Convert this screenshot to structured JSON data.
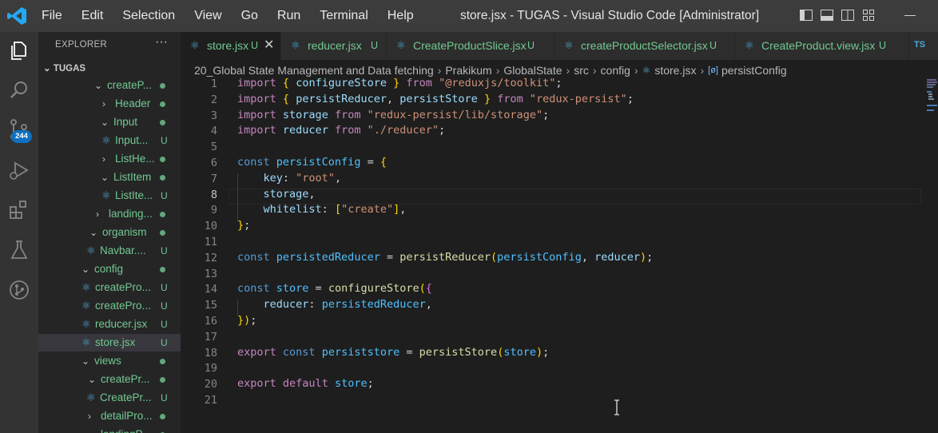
{
  "window": {
    "title": "store.jsx - TUGAS - Visual Studio Code [Administrator]",
    "menu": [
      "File",
      "Edit",
      "Selection",
      "View",
      "Go",
      "Run",
      "Terminal",
      "Help"
    ]
  },
  "activity_bar": {
    "items": [
      "explorer-icon",
      "search-icon",
      "source-control-icon",
      "run-debug-icon",
      "extensions-icon",
      "testing-icon",
      "git-graph-icon"
    ],
    "source_control_badge": "244",
    "accent": "#0e70c0"
  },
  "sidebar": {
    "header": "EXPLORER",
    "more": "···",
    "folder": "TUGAS",
    "tree": [
      {
        "twist": "⌄",
        "icon": "",
        "name": "createP...",
        "status": "dot"
      },
      {
        "twist": "›",
        "icon": "",
        "name": "Header",
        "status": "dot"
      },
      {
        "twist": "⌄",
        "icon": "",
        "name": "Input",
        "status": "dot"
      },
      {
        "twist": "",
        "icon": "react",
        "name": "Input...",
        "status": "U"
      },
      {
        "twist": "›",
        "icon": "",
        "name": "ListHe...",
        "status": "dot"
      },
      {
        "twist": "⌄",
        "icon": "",
        "name": "ListItem",
        "status": "dot"
      },
      {
        "twist": "",
        "icon": "react",
        "name": "ListIte...",
        "status": "U"
      },
      {
        "twist": "›",
        "icon": "",
        "name": "landing...",
        "status": "dot"
      },
      {
        "twist": "⌄",
        "icon": "",
        "name": "organism",
        "status": "dot"
      },
      {
        "twist": "",
        "icon": "react",
        "name": "Navbar....",
        "status": "U"
      },
      {
        "twist": "⌄",
        "icon": "",
        "name": "config",
        "status": "dot"
      },
      {
        "twist": "",
        "icon": "react",
        "name": "createPro...",
        "status": "U"
      },
      {
        "twist": "",
        "icon": "react",
        "name": "createPro...",
        "status": "U"
      },
      {
        "twist": "",
        "icon": "react",
        "name": "reducer.jsx",
        "status": "U"
      },
      {
        "twist": "",
        "icon": "react",
        "name": "store.jsx",
        "status": "U",
        "selected": true
      },
      {
        "twist": "⌄",
        "icon": "",
        "name": "views",
        "status": "dot"
      },
      {
        "twist": "⌄",
        "icon": "",
        "name": "createPr...",
        "status": "dot"
      },
      {
        "twist": "",
        "icon": "react",
        "name": "CreatePr...",
        "status": "U"
      },
      {
        "twist": "›",
        "icon": "",
        "name": "detailPro...",
        "status": "dot"
      },
      {
        "twist": "›",
        "icon": "",
        "name": "landingP...",
        "status": "dot"
      }
    ]
  },
  "tabs": [
    {
      "label": "store.jsx",
      "status": "U",
      "active": true,
      "close": "✕"
    },
    {
      "label": "reducer.jsx",
      "status": "U"
    },
    {
      "label": "CreateProductSlice.jsx",
      "status": "U"
    },
    {
      "label": "createProductSelector.jsx",
      "status": "U"
    },
    {
      "label": "CreateProduct.view.jsx",
      "status": "U"
    },
    {
      "label": "TS",
      "status": ""
    }
  ],
  "breadcrumb": {
    "parts": [
      "20_Global State Management and Data fetching",
      "Prakikum",
      "GlobalState",
      "src",
      "config",
      "store.jsx",
      "persistConfig"
    ],
    "separator": "›",
    "symbol_glyph": "[ø]"
  },
  "editor": {
    "current_line": 8,
    "lines": [
      "import { configureStore } from \"@reduxjs/toolkit\";",
      "import { persistReducer, persistStore } from \"redux-persist\";",
      "import storage from \"redux-persist/lib/storage\";",
      "import reducer from \"./reducer\";",
      "",
      "const persistConfig = {",
      "    key: \"root\",",
      "    storage,",
      "    whitelist: [\"create\"],",
      "};",
      "",
      "const persistedReducer = persistReducer(persistConfig, reducer);",
      "",
      "const store = configureStore({",
      "    reducer: persistedReducer,",
      "});",
      "",
      "export const persiststore = persistStore(store);",
      "",
      "export default store;",
      ""
    ]
  }
}
